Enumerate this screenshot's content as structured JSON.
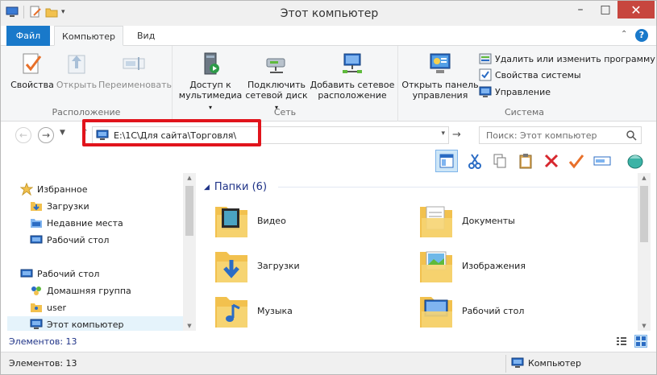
{
  "window": {
    "title": "Этот компьютер"
  },
  "title_controls": {
    "minimize": "–",
    "maximize": "□",
    "close": "✕"
  },
  "tabs": {
    "file": "Файл",
    "computer": "Компьютер",
    "view": "Вид"
  },
  "ribbon": {
    "location": {
      "label": "Расположение",
      "properties": "Свойства",
      "open": "Открыть",
      "rename": "Переименовать"
    },
    "network": {
      "label": "Сеть",
      "media_line1": "Доступ к",
      "media_line2": "мультимедиа",
      "map_line1": "Подключить",
      "map_line2": "сетевой диск",
      "add_line1": "Добавить сетевое",
      "add_line2": "расположение"
    },
    "system": {
      "label": "Система",
      "cpanel_line1": "Открыть панель",
      "cpanel_line2": "управления",
      "uninstall": "Удалить или изменить программу",
      "sysprops": "Свойства системы",
      "manage": "Управление"
    }
  },
  "address": {
    "path": "E:\\1C\\Для сайта\\Торговля\\"
  },
  "search": {
    "placeholder": "Поиск: Этот компьютер"
  },
  "nav": {
    "favorites": "Избранное",
    "downloads": "Загрузки",
    "recent": "Недавние места",
    "desktop_fav": "Рабочий стол",
    "desktop": "Рабочий стол",
    "homegroup": "Домашняя группа",
    "user": "user",
    "thispc": "Этот компьютер"
  },
  "main": {
    "group_header": "Папки (6)",
    "folders": [
      {
        "name": "Видео"
      },
      {
        "name": "Документы"
      },
      {
        "name": "Загрузки"
      },
      {
        "name": "Изображения"
      },
      {
        "name": "Музыка"
      },
      {
        "name": "Рабочий стол"
      }
    ]
  },
  "status": {
    "items_blue": "Элементов: 13",
    "items": "Элементов: 13",
    "location": "Компьютер"
  },
  "colors": {
    "accent": "#1979ca",
    "highlight_frame": "#e1141c",
    "folder": "#f2c14e",
    "group_header": "#1e3287"
  }
}
